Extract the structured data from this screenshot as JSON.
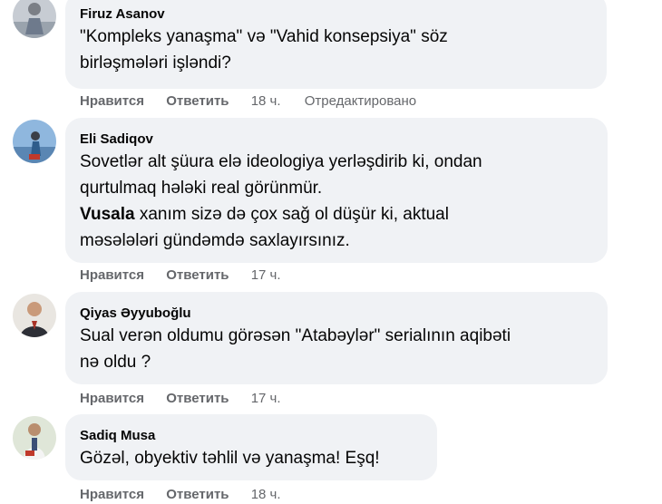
{
  "comments": [
    {
      "author": "Firuz Asanov",
      "lines": [
        "\"Kompleks yanaşma\" və \"Vahid konsepsiya\" söz",
        "birləşmələri işləndi?"
      ],
      "like": "Нравится",
      "reply": "Ответить",
      "time": "18 ч.",
      "edited": "Отредактировано"
    },
    {
      "author": "Eli Sadiqov",
      "lines": [
        "Sovetlər alt şüura elə ideologiya yerləşdirib ki, ondan",
        "qurtulmaq hələki real görünmür."
      ],
      "mention": "Vusala",
      "mention_rest": " xanım sizə də çox sağ ol düşür ki, aktual",
      "line4": "məsələləri gündəmdə saxlayırsınız.",
      "like": "Нравится",
      "reply": "Ответить",
      "time": "17 ч."
    },
    {
      "author": "Qiyas Əyyuboğlu",
      "lines": [
        "Sual verən oldumu görəsən \"Atabəylər\" serialının aqibəti",
        "nə oldu ?"
      ],
      "like": "Нравится",
      "reply": "Ответить",
      "time": "17 ч."
    },
    {
      "author": "Sadiq Musa",
      "lines": [
        "Gözəl, obyektiv təhlil və yanaşma! Eşq!"
      ],
      "like": "Нравится",
      "reply": "Ответить",
      "time": "18 ч."
    }
  ]
}
